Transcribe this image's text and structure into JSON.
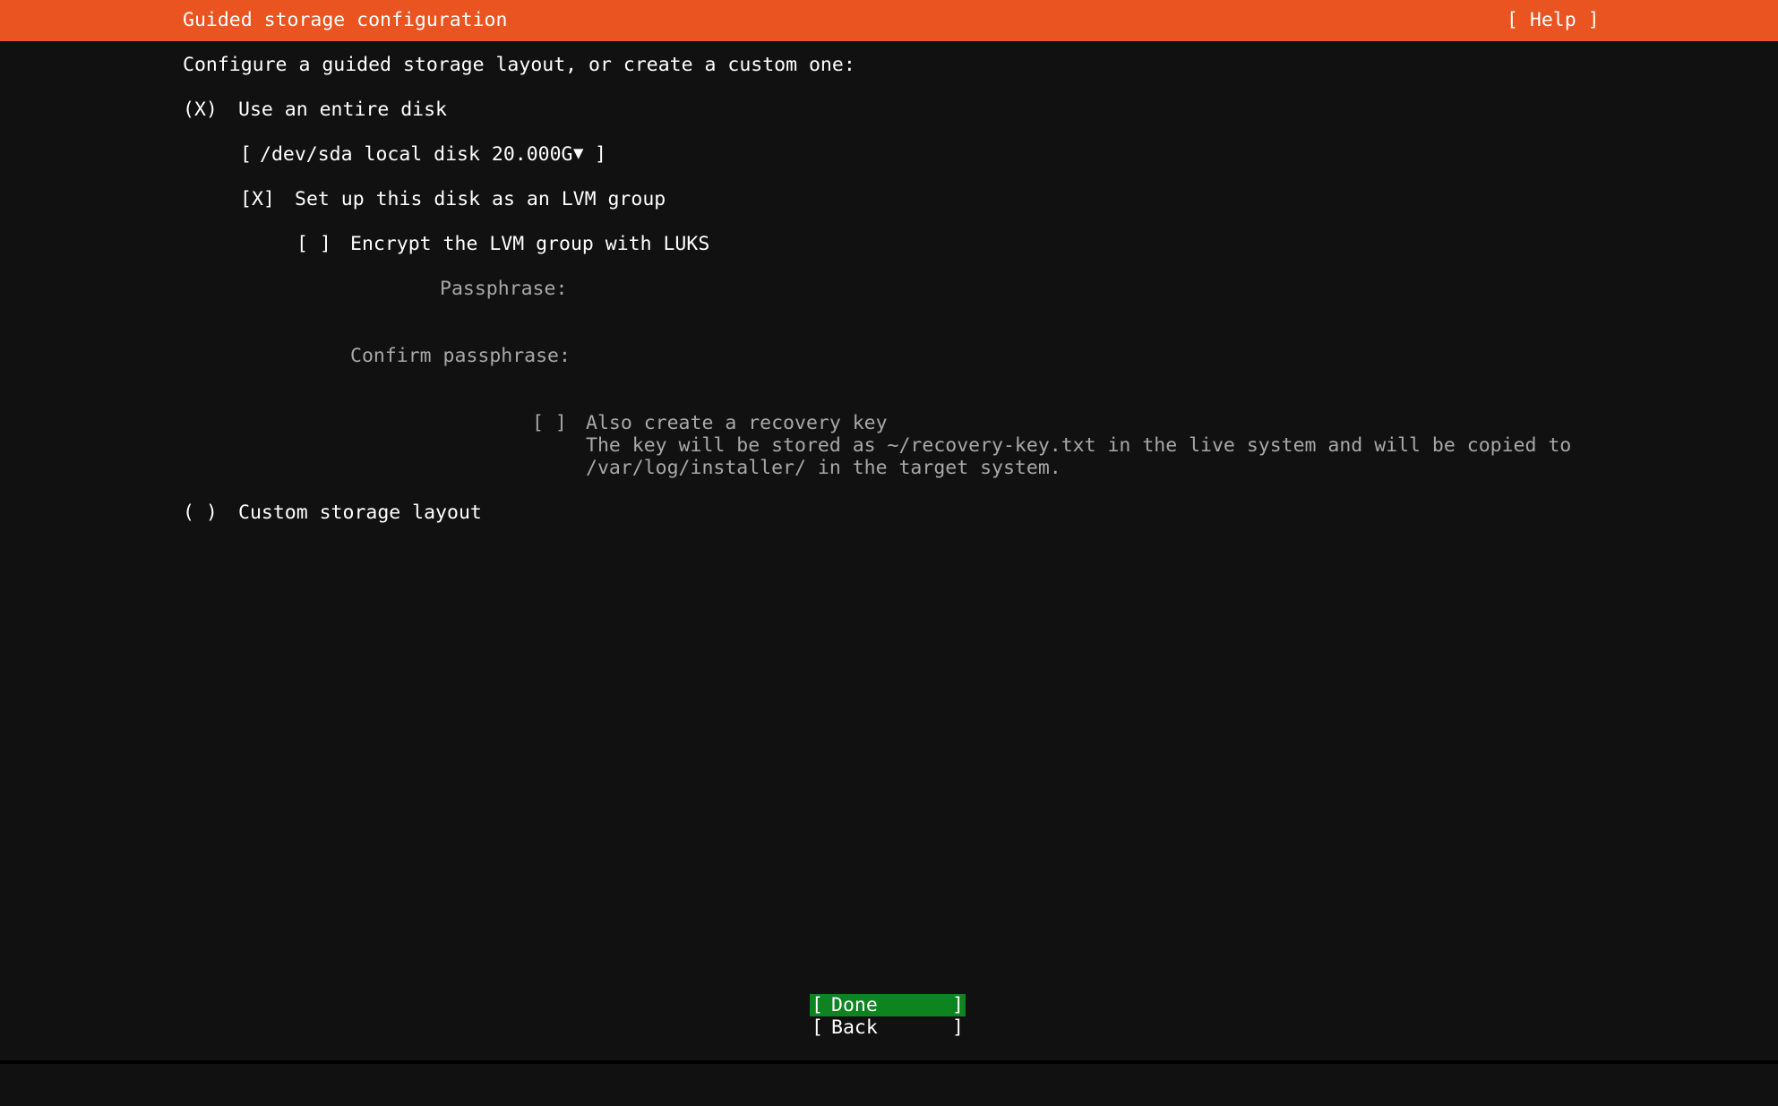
{
  "header": {
    "title": "Guided storage configuration",
    "help_label": "[ Help ]"
  },
  "main": {
    "intro": "Configure a guided storage layout, or create a custom one:",
    "entire_disk": {
      "marker": "(X)",
      "label": "Use an entire disk"
    },
    "disk_select": {
      "open": "[",
      "value": "/dev/sda local disk 20.000G",
      "arrow": "▼",
      "close": "]"
    },
    "lvm": {
      "marker": "[X]",
      "label": "Set up this disk as an LVM group"
    },
    "luks": {
      "marker": "[ ]",
      "label": "Encrypt the LVM group with LUKS"
    },
    "passphrase": {
      "label": "Passphrase:",
      "value": ""
    },
    "confirm_passphrase": {
      "label": "Confirm passphrase:",
      "value": ""
    },
    "recovery_key": {
      "marker": "[ ]",
      "label": "Also create a recovery key",
      "desc_line1": "The key will be stored as ~/recovery-key.txt in the live system and will be copied to",
      "desc_line2": "/var/log/installer/ in the target system."
    },
    "custom_layout": {
      "marker": "( )",
      "label": "Custom storage layout"
    }
  },
  "buttons": {
    "done": {
      "open": "[",
      "label": "Done",
      "close": "]"
    },
    "back": {
      "open": "[",
      "label": "Back",
      "close": "]"
    }
  },
  "colors": {
    "header_bg": "#e95420",
    "done_bg": "#0e8420",
    "background": "#111111",
    "dim_text": "#a8a8a8"
  }
}
